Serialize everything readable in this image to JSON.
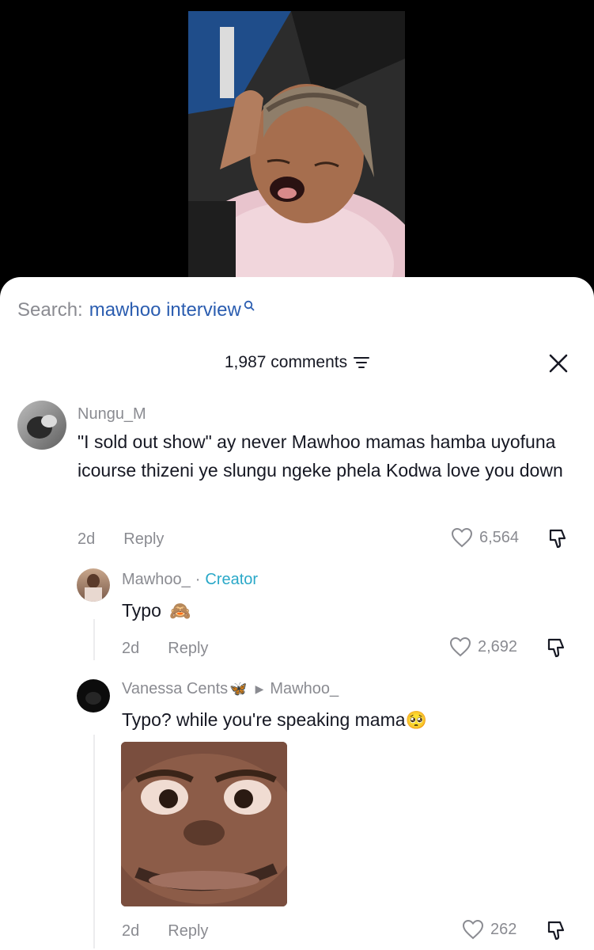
{
  "search": {
    "prefix": "Search:",
    "term": "mawhoo interview"
  },
  "comments_header": {
    "count_label": "1,987 comments"
  },
  "comments": [
    {
      "username": "Nungu_M",
      "text": "\"I sold out show\" ay never Mawhoo mamas hamba uyofuna icourse thizeni ye slungu ngeke phela Kodwa love you down",
      "age": "2d",
      "reply_label": "Reply",
      "likes": "6,564"
    },
    {
      "username": "Mawhoo_",
      "creator_tag": "Creator",
      "separator": "·",
      "text": "Typo",
      "emoji": "🙈",
      "age": "2d",
      "reply_label": "Reply",
      "likes": "2,692"
    },
    {
      "username": "Vanessa Cents",
      "username_emoji": "🦋",
      "reply_to": "Mawhoo_",
      "text": "Typo? while you're speaking mama",
      "emoji": "🥺",
      "age": "2d",
      "reply_label": "Reply",
      "likes": "262"
    }
  ],
  "icons": {
    "search": "search-icon",
    "filter": "filter-icon",
    "close": "close-icon",
    "like": "heart-icon",
    "dislike": "thumbs-down-icon",
    "reply_arrow": "triangle-right-icon"
  },
  "colors": {
    "background": "#000000",
    "sheet": "#ffffff",
    "search_term": "#2b5db0",
    "creator_tag": "#2aa8c8",
    "muted": "#8a8b91",
    "text": "#161823"
  }
}
